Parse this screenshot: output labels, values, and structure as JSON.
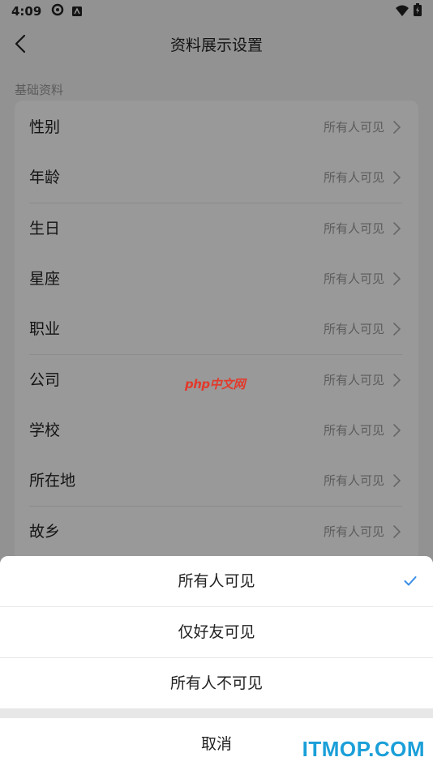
{
  "status_bar": {
    "time": "4:09"
  },
  "header": {
    "title": "资料展示设置"
  },
  "section": {
    "label": "基础资料"
  },
  "rows": [
    {
      "label": "性别",
      "value": "所有人可见"
    },
    {
      "label": "年龄",
      "value": "所有人可见"
    },
    {
      "label": "生日",
      "value": "所有人可见"
    },
    {
      "label": "星座",
      "value": "所有人可见"
    },
    {
      "label": "职业",
      "value": "所有人可见"
    },
    {
      "label": "公司",
      "value": "所有人可见"
    },
    {
      "label": "学校",
      "value": "所有人可见"
    },
    {
      "label": "所在地",
      "value": "所有人可见"
    },
    {
      "label": "故乡",
      "value": "所有人可见"
    }
  ],
  "watermark": {
    "part1": "php",
    "part2": "中文网"
  },
  "sheet": {
    "options": [
      {
        "label": "所有人可见",
        "selected": true
      },
      {
        "label": "仅好友可见",
        "selected": false
      },
      {
        "label": "所有人不可见",
        "selected": false
      }
    ],
    "cancel_label": "取消"
  },
  "brand": {
    "text": "ITMOP.COM"
  },
  "colors": {
    "accent": "#1a9fd8",
    "overlay": "rgba(0,0,0,0.40)",
    "check": "#3a8ee6"
  }
}
